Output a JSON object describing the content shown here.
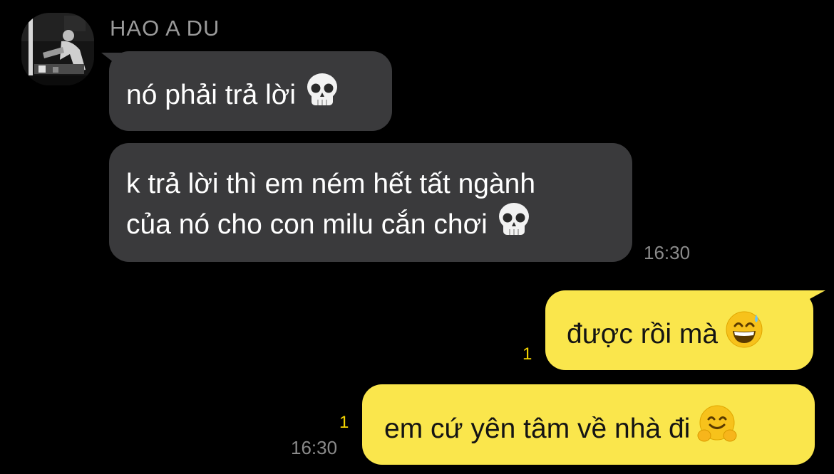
{
  "sender": {
    "name": "HAO A DU",
    "avatar": "avatar-photo"
  },
  "incoming": [
    {
      "text": "nó phải trả lời",
      "emoji": "skull-icon"
    },
    {
      "line1": "k trả lời thì em ném hết tất ngành",
      "line2": "của nó cho con milu cắn chơi",
      "emoji": "skull-icon",
      "time": "16:30"
    }
  ],
  "outgoing": [
    {
      "text": "được rồi mà",
      "emoji": "grinning-sweat-icon",
      "unread": "1"
    },
    {
      "text": "em cứ yên tâm về nhà đi",
      "emoji": "hugging-face-icon",
      "unread": "1",
      "time": "16:30"
    }
  ],
  "colors": {
    "background": "#000000",
    "incoming_bubble": "#3a3a3c",
    "outgoing_bubble": "#fae64c",
    "unread": "#f5d400",
    "timestamp": "#8a8a8a"
  }
}
